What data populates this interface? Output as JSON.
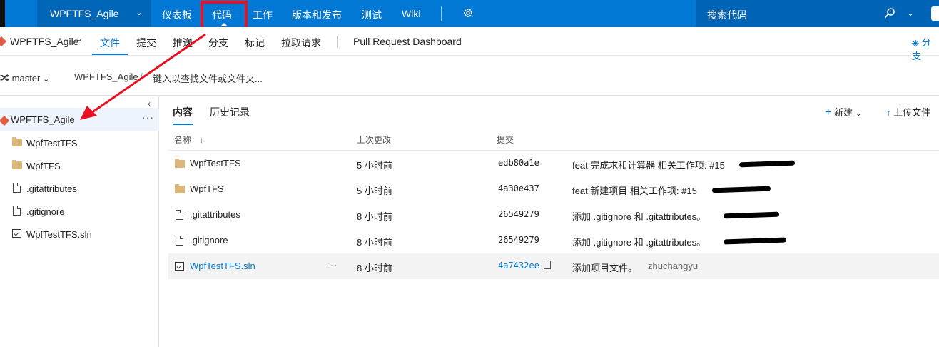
{
  "topbar": {
    "project": "WPFTFS_Agile",
    "nav": [
      "仪表板",
      "代码",
      "工作",
      "版本和发布",
      "测试",
      "Wiki"
    ],
    "search_placeholder": "搜索代码"
  },
  "subbar": {
    "repo": "WPFTFS_Agile",
    "tabs": [
      "文件",
      "提交",
      "推送",
      "分支",
      "标记",
      "拉取请求"
    ],
    "dashboard": "Pull Request Dashboard",
    "right_action": "分支"
  },
  "pathbar": {
    "branch": "master",
    "crumb": "WPFTFS_Agile",
    "path_placeholder": "键入以查找文件或文件夹..."
  },
  "tree": {
    "root": "WPFTFS_Agile",
    "items": [
      {
        "label": "WpfTestTFS",
        "icon": "folder-icon"
      },
      {
        "label": "WpfTFS",
        "icon": "folder-icon"
      },
      {
        "label": ".gitattributes",
        "icon": "file-icon"
      },
      {
        "label": ".gitignore",
        "icon": "file-icon"
      },
      {
        "label": "WpfTestTFS.sln",
        "icon": "solution-icon"
      }
    ]
  },
  "main": {
    "tabs": [
      "内容",
      "历史记录"
    ],
    "new_label": "新建",
    "upload_label": "上传文件",
    "columns": {
      "name": "名称",
      "changed": "上次更改",
      "commit": "提交"
    },
    "rows": [
      {
        "name": "WpfTestTFS",
        "icon": "folder-icon",
        "time": "5 小时前",
        "hash": "edb80a1e",
        "message": "feat:完成求和计算器 相关工作项: #15"
      },
      {
        "name": "WpfTFS",
        "icon": "folder-icon",
        "time": "5 小时前",
        "hash": "4a30e437",
        "message": "feat:新建项目 相关工作项: #15"
      },
      {
        "name": ".gitattributes",
        "icon": "file-icon",
        "time": "8 小时前",
        "hash": "26549279",
        "message": "添加 .gitignore 和 .gitattributes。"
      },
      {
        "name": ".gitignore",
        "icon": "file-icon",
        "time": "8 小时前",
        "hash": "26549279",
        "message": "添加 .gitignore 和 .gitattributes。"
      },
      {
        "name": "WpfTestTFS.sln",
        "icon": "solution-icon",
        "time": "8 小时前",
        "hash": "4a7432ee",
        "message": "添加项目文件。",
        "author": "zhuchangyu"
      }
    ]
  },
  "colors": {
    "accent": "#0078d4",
    "highlight": "#e81123",
    "folder": "#dcb67a"
  }
}
